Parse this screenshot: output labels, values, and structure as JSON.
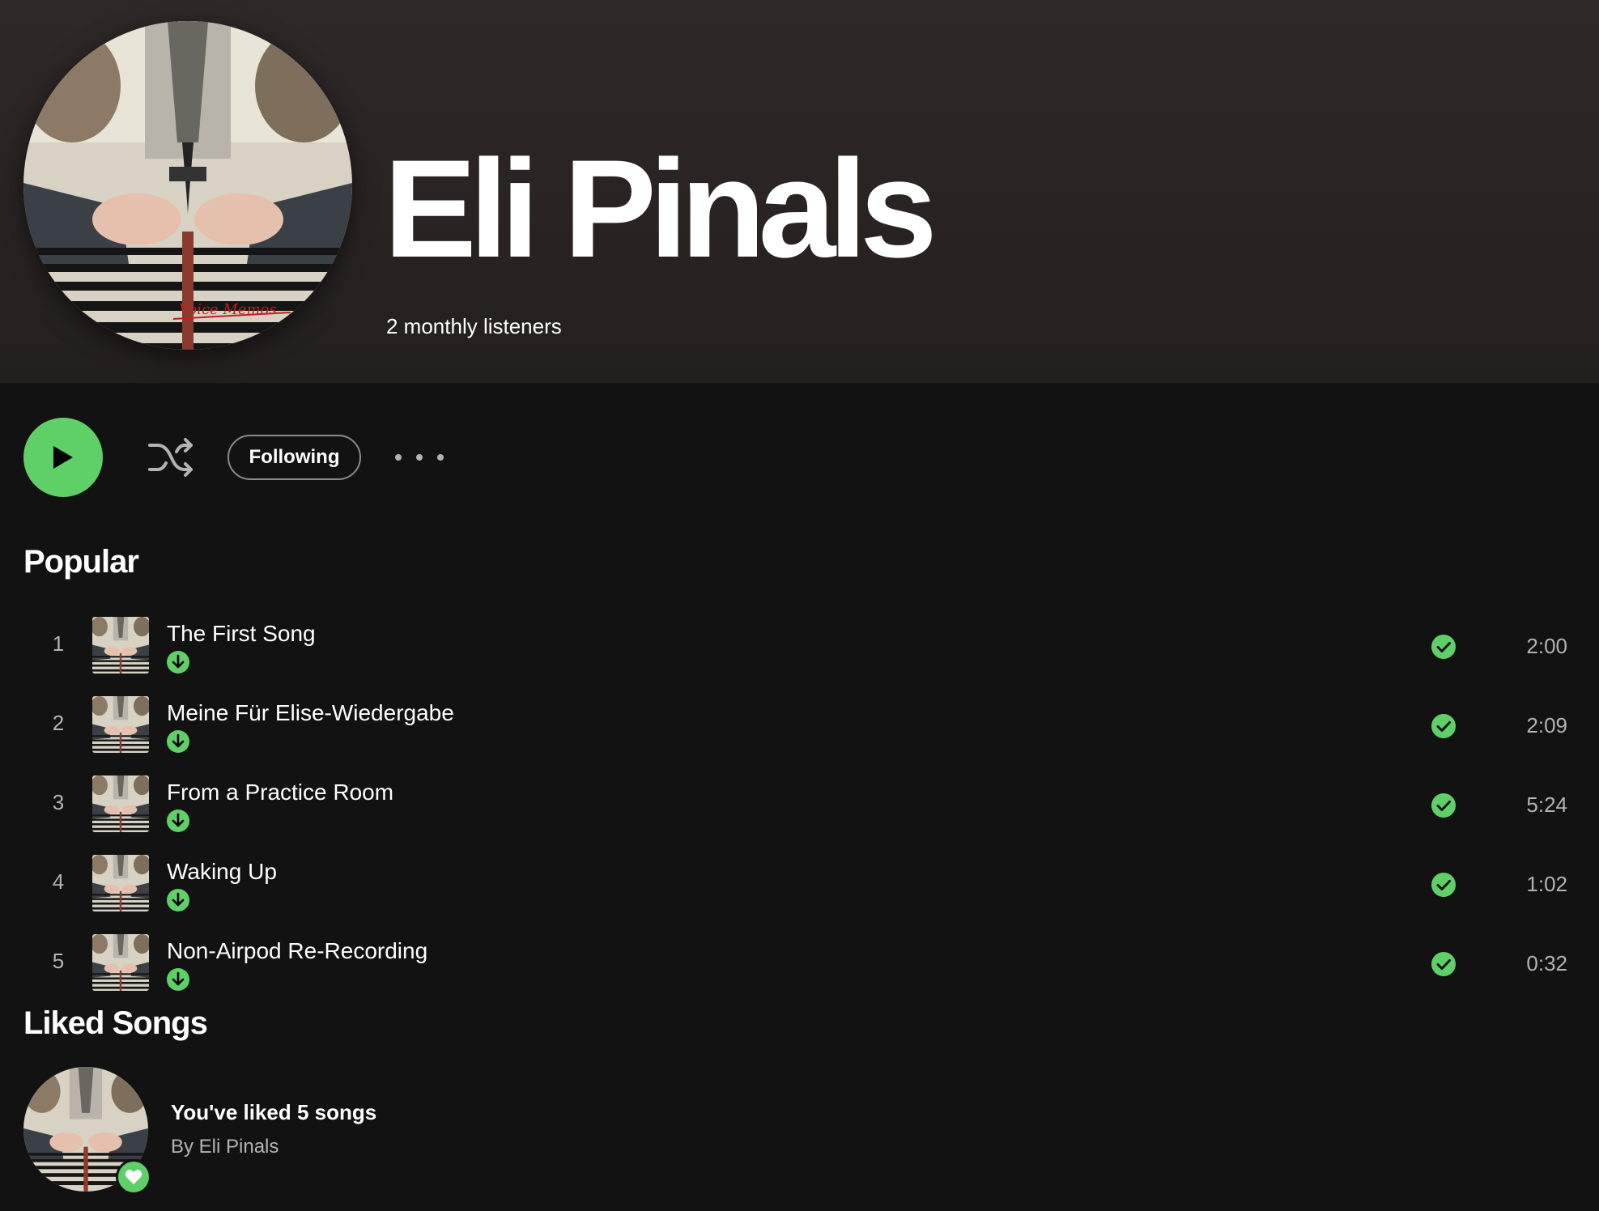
{
  "artist": {
    "name": "Eli Pinals",
    "monthly_listeners": "2 monthly listeners",
    "avatar_caption": "Voice Memos"
  },
  "actions": {
    "play_icon": "play-icon",
    "shuffle_icon": "shuffle-icon",
    "follow_label": "Following",
    "more_icon": "more-options-icon"
  },
  "popular": {
    "title": "Popular",
    "tracks": [
      {
        "number": "1",
        "title": "The First Song",
        "duration": "2:00"
      },
      {
        "number": "2",
        "title": "Meine Für Elise-Wiedergabe",
        "duration": "2:09"
      },
      {
        "number": "3",
        "title": "From a Practice Room",
        "duration": "5:24"
      },
      {
        "number": "4",
        "title": "Waking Up",
        "duration": "1:02"
      },
      {
        "number": "5",
        "title": "Non-Airpod Re-Recording",
        "duration": "0:32"
      }
    ]
  },
  "liked": {
    "title": "Liked Songs",
    "summary": "You've liked 5 songs",
    "by": "By Eli Pinals"
  },
  "colors": {
    "accent": "#5fd068",
    "background": "#121212",
    "header": "#2f2828",
    "secondary_text": "#b3b3b3"
  }
}
